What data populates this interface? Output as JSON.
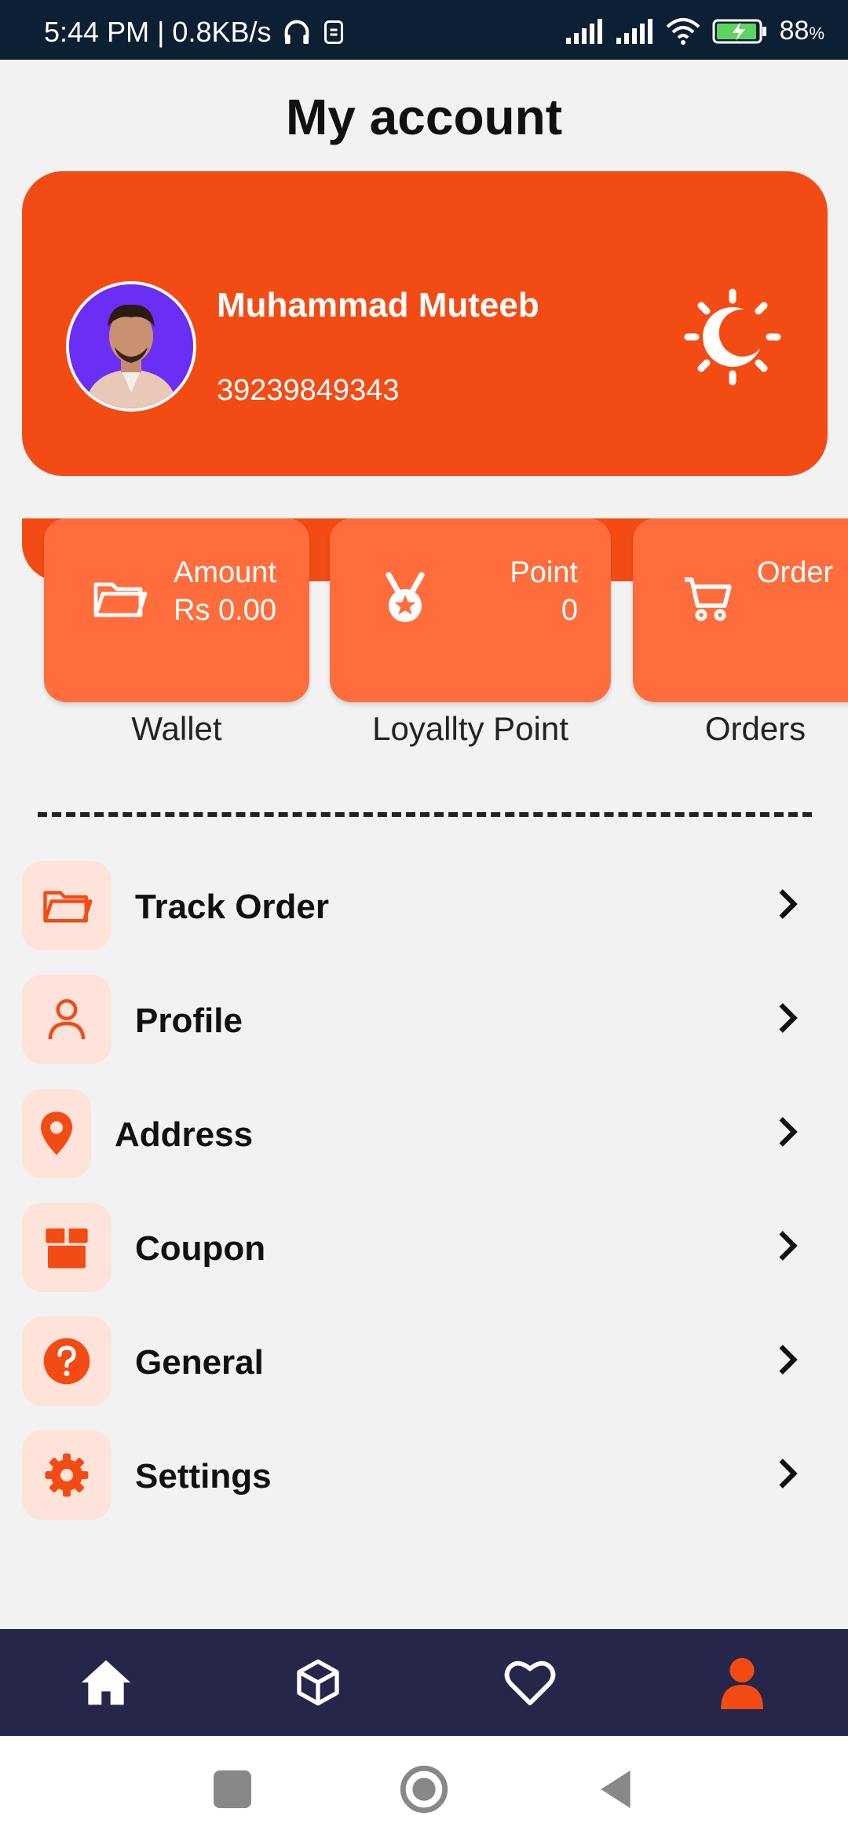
{
  "status_bar": {
    "time_speed": "5:44 PM | 0.8KB/s",
    "battery": "88",
    "battery_unit": "%"
  },
  "page": {
    "title": "My account"
  },
  "profile": {
    "name": "Muhammad Muteeb",
    "phone": "39239849343",
    "theme_icon": "sun-moon-icon"
  },
  "stats": [
    {
      "label": "Amount",
      "value": "Rs 0.00",
      "caption": "Wallet",
      "icon": "folder-icon"
    },
    {
      "label": "Point",
      "value": "0",
      "caption": "Loyallty Point",
      "icon": "medal-icon"
    },
    {
      "label": "Order",
      "value": "",
      "caption": "Orders",
      "icon": "cart-icon"
    }
  ],
  "menu": [
    {
      "label": "Track Order",
      "icon": "folder-icon"
    },
    {
      "label": "Profile",
      "icon": "user-icon"
    },
    {
      "label": "Address",
      "icon": "location-pin-icon"
    },
    {
      "label": "Coupon",
      "icon": "gift-box-icon"
    },
    {
      "label": "General",
      "icon": "question-icon"
    },
    {
      "label": "Settings",
      "icon": "gear-icon"
    }
  ],
  "bottom_nav": [
    {
      "name": "home",
      "icon": "home-icon"
    },
    {
      "name": "products",
      "icon": "cube-icon"
    },
    {
      "name": "wishlist",
      "icon": "heart-icon"
    },
    {
      "name": "account",
      "icon": "person-icon",
      "active": true
    }
  ],
  "colors": {
    "accent": "#f24c14",
    "card_light": "#ff6d3d",
    "nav_bg": "#26264a",
    "status_bg": "#0d1f33"
  }
}
